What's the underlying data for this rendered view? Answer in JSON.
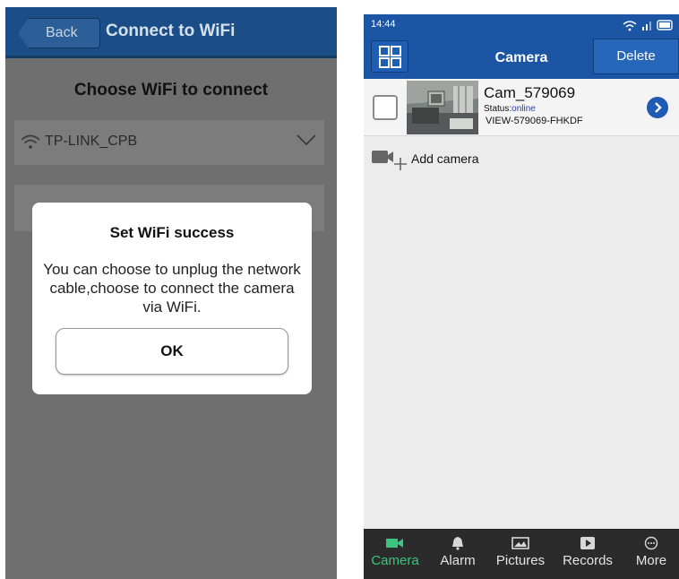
{
  "left_screen": {
    "header": {
      "back_label": "Back",
      "title": "Connect to WiFi"
    },
    "choose_title": "Choose WiFi to connect",
    "wifi": {
      "selected_network": "TP-LINK_CPB"
    },
    "dialog": {
      "title": "Set WiFi success",
      "message": "You can choose to unplug the network cable,choose to connect the camera via WiFi.",
      "ok_label": "OK"
    }
  },
  "right_screen": {
    "status_bar": {
      "time": "14:44"
    },
    "nav": {
      "title": "Camera",
      "delete_label": "Delete"
    },
    "camera_item": {
      "name": "Cam_579069",
      "status_label": "Status:",
      "status_value": "online",
      "device_id": "VIEW-579069-FHKDF"
    },
    "add_camera_label": "Add camera",
    "tabs": [
      {
        "label": "Camera",
        "icon": "video-camera-icon",
        "active": true
      },
      {
        "label": "Alarm",
        "icon": "bell-icon",
        "active": false
      },
      {
        "label": "Pictures",
        "icon": "picture-icon",
        "active": false
      },
      {
        "label": "Records",
        "icon": "record-play-icon",
        "active": false
      },
      {
        "label": "More",
        "icon": "more-dots-icon",
        "active": false
      }
    ],
    "colors": {
      "nav_blue": "#1b55a4",
      "active_tab": "#3bc47f",
      "status_online": "#1a3fc4"
    }
  }
}
